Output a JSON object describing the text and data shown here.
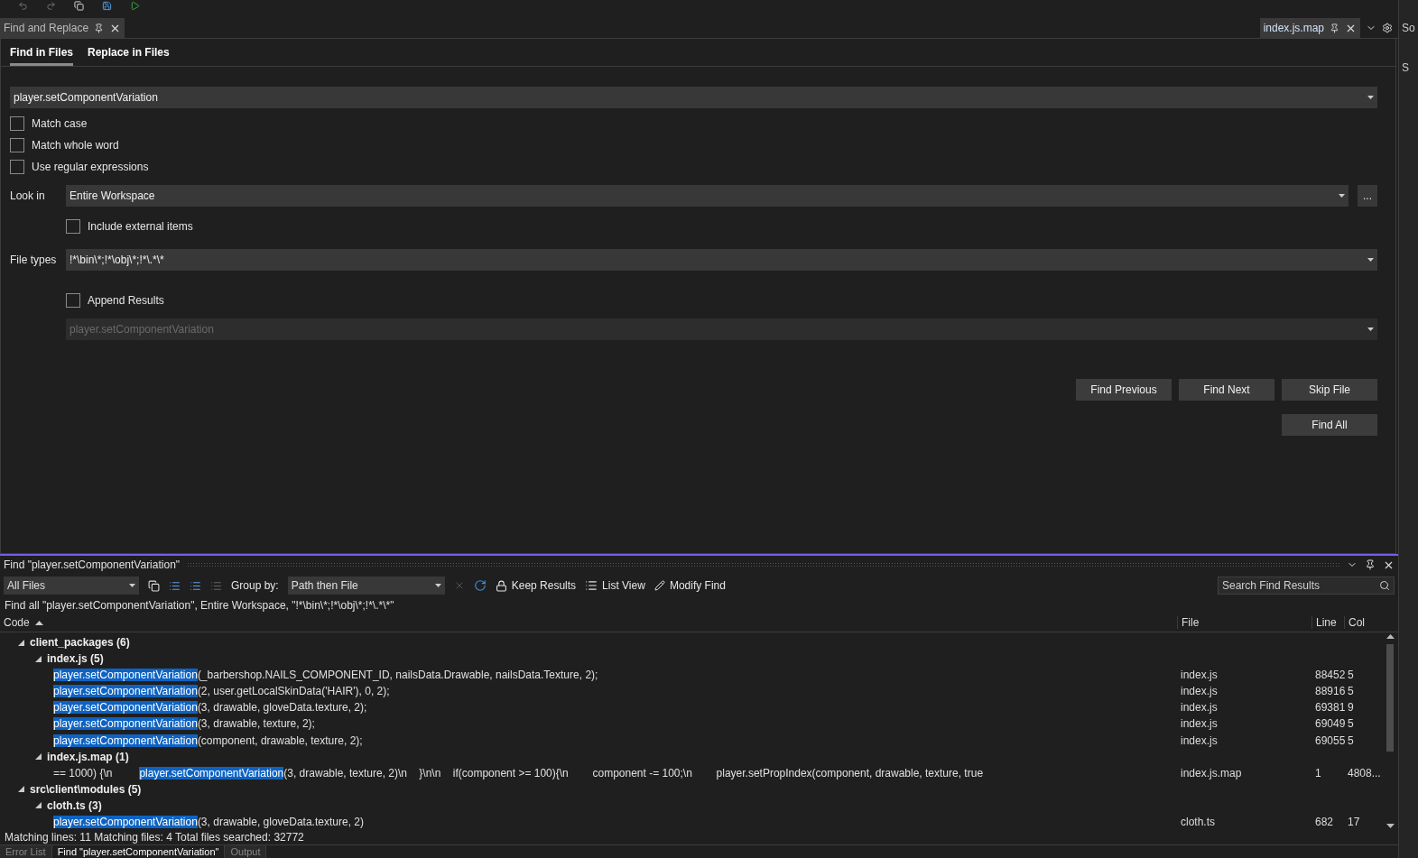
{
  "tool_tab": {
    "label": "Find and Replace"
  },
  "document_tab": {
    "label": "index.js.map"
  },
  "find_tabs": [
    {
      "label": "Find in Files",
      "selected": true
    },
    {
      "label": "Replace in Files",
      "selected": false
    }
  ],
  "find_what": {
    "value": "player.setComponentVariation"
  },
  "options": [
    {
      "label": "Match case",
      "checked": false
    },
    {
      "label": "Match whole word",
      "checked": false
    },
    {
      "label": "Use regular expressions",
      "checked": false
    }
  ],
  "look_in": {
    "label": "Look in",
    "value": "Entire Workspace",
    "browse": "..."
  },
  "include_external": {
    "label": "Include external items",
    "checked": false
  },
  "file_types": {
    "label": "File types",
    "value": "!*\\bin\\*;!*\\obj\\*;!*\\.*\\*"
  },
  "append_results": {
    "label": "Append Results",
    "checked": false
  },
  "results_window": {
    "value": "player.setComponentVariation",
    "disabled": true
  },
  "button_rows": [
    [
      "Find Previous",
      "Find Next",
      "Skip File"
    ],
    [
      "Find All"
    ]
  ],
  "results": {
    "title": "Find \"player.setComponentVariation\"",
    "scope": "All Files",
    "group_by_label": "Group by:",
    "group_by": "Path then File",
    "keep_results": "Keep Results",
    "list_view": "List View",
    "modify_find": "Modify Find",
    "search_placeholder": "Search Find Results",
    "summary": "Find all \"player.setComponentVariation\", Entire Workspace, \"!*\\bin\\*;!*\\obj\\*;!*\\.*\\*\"",
    "columns": [
      "Code",
      "File",
      "Line",
      "Col"
    ],
    "tree": [
      {
        "label": "client_packages (6)",
        "expanded": true,
        "children": [
          {
            "label": "index.js (5)",
            "expanded": true,
            "children": [
              {
                "match": "player.setComponentVariation",
                "rest": "(_barbershop.NAILS_COMPONENT_ID, nailsData.Drawable, nailsData.Texture, 2);",
                "file": "index.js",
                "line": "88452",
                "col": "5"
              },
              {
                "match": "player.setComponentVariation",
                "rest": "(2, user.getLocalSkinData('HAIR'), 0, 2);",
                "file": "index.js",
                "line": "88916",
                "col": "5"
              },
              {
                "match": "player.setComponentVariation",
                "rest": "(3, drawable, gloveData.texture, 2);",
                "file": "index.js",
                "line": "69381",
                "col": "9"
              },
              {
                "match": "player.setComponentVariation",
                "rest": "(3, drawable, texture, 2);",
                "file": "index.js",
                "line": "69049",
                "col": "5"
              },
              {
                "match": "player.setComponentVariation",
                "rest": "(component, drawable, texture, 2);",
                "file": "index.js",
                "line": "69055",
                "col": "5"
              }
            ]
          },
          {
            "label": "index.js.map (1)",
            "expanded": true,
            "children": [
              {
                "prefix": "== 1000) {\\n         ",
                "match": "player.setComponentVariation",
                "rest": "(3, drawable, texture, 2)\\n    }\\n\\n    if(component >= 100){\\n        component -= 100;\\n        player.setPropIndex(component, drawable, texture, true",
                "file": "index.js.map",
                "line": "1",
                "col": "4808..."
              }
            ]
          }
        ]
      },
      {
        "label": "src\\client\\modules (5)",
        "expanded": true,
        "children": [
          {
            "label": "cloth.ts (3)",
            "expanded": true,
            "children": [
              {
                "match": "player.setComponentVariation",
                "rest": "(3, drawable, gloveData.texture, 2)",
                "file": "cloth.ts",
                "line": "682",
                "col": "17"
              }
            ]
          }
        ]
      }
    ],
    "status": "Matching lines: 11 Matching files: 4 Total files searched: 32772"
  },
  "bottom_tabs": [
    {
      "label": "Error List",
      "selected": false
    },
    {
      "label": "Find \"player.setComponentVariation\"",
      "selected": true
    },
    {
      "label": "Output",
      "selected": false
    }
  ],
  "side_panel": [
    "So",
    "S"
  ]
}
